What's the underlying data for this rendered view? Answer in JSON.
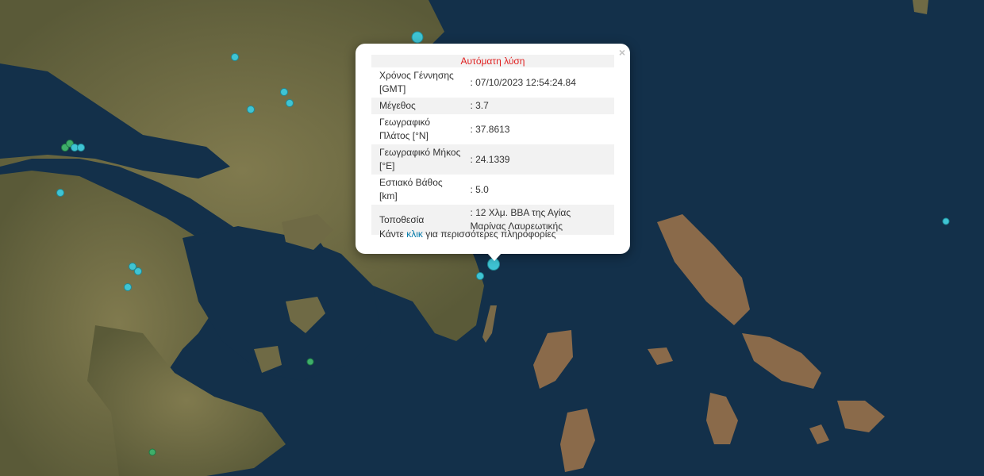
{
  "popup": {
    "title": "Αυτόματη λύση",
    "close_symbol": "×",
    "rows": [
      {
        "label": "Χρόνος Γέννησης [GMT]",
        "value": ": 07/10/2023 12:54:24.84"
      },
      {
        "label": "Μέγεθος",
        "value": ": 3.7"
      },
      {
        "label": "Γεωγραφικό Πλάτος [°N]",
        "value": ": 37.8613"
      },
      {
        "label": "Γεωγραφικό Μήκος [°E]",
        "value": ": 24.1339"
      },
      {
        "label": "Εστιακό Βάθος [km]",
        "value": ": 5.0"
      },
      {
        "label": "Τοποθεσία",
        "value": ": 12 Χλμ. ΒΒΑ της Αγίας Μαρίνας Λαυρεωτικής"
      }
    ],
    "more_prefix": "Κάντε",
    "more_link": "κλικ",
    "more_suffix": "για περισσότερες πληροφορίες"
  },
  "colors": {
    "sea": "#13304a",
    "land": "#6e6a44",
    "marker_cyan": "#3fc4d4",
    "marker_green": "#3fae6a",
    "title_red": "#e02020",
    "link": "#0078a8"
  },
  "markers": [
    {
      "type": "earthquake",
      "color": "cyan",
      "selected": true
    },
    {
      "type": "earthquake",
      "color": "green"
    }
  ]
}
